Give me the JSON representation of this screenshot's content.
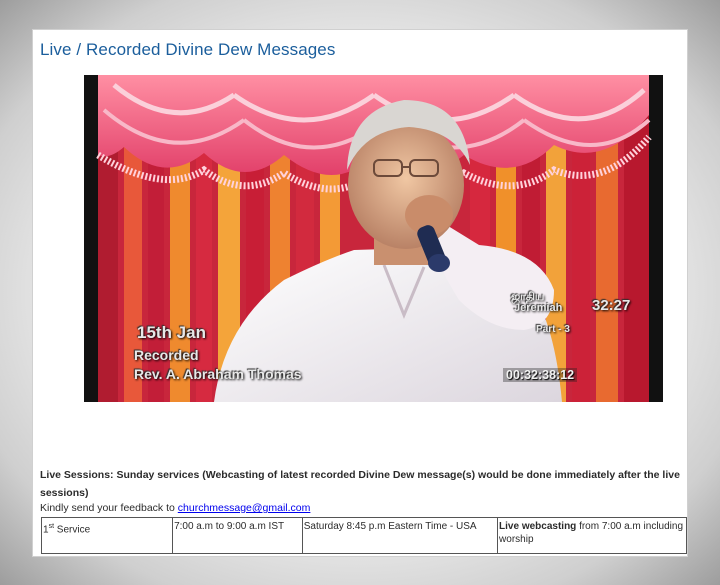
{
  "page": {
    "title": "Live / Recorded Divine Dew Messages"
  },
  "video": {
    "overlay_date": "15th Jan",
    "overlay_recorded": "Recorded",
    "overlay_speaker": "Rev. A. Abraham Thomas",
    "overlay_verse_line1": "ஜாதிய",
    "overlay_verse_line2": "Jeremiah",
    "overlay_verse_number": "32:27",
    "overlay_part": "Part - 3",
    "timecode": "00:32:38:12"
  },
  "info": {
    "live_sessions": "Live Sessions: Sunday services (Webcasting of latest recorded Divine Dew message(s) would be done immediately after the live sessions)",
    "feedback_prefix": "Kindly send your feedback to ",
    "feedback_email": "churchmessage@gmail.com"
  },
  "schedule": {
    "rows": [
      {
        "service_num": "1",
        "service_sup": "st",
        "service_label": " Service",
        "ist_time": "7:00 a.m to 9:00 a.m IST",
        "us_time": "Saturday 8:45 p.m Eastern Time - USA",
        "note_bold": "Live webcasting",
        "note_rest": " from 7:00 a.m including worship"
      }
    ]
  },
  "colors": {
    "title": "#1b5e9c",
    "link": "#0000ee",
    "curtain_red": "#d9233a",
    "curtain_orange": "#f0902a"
  }
}
